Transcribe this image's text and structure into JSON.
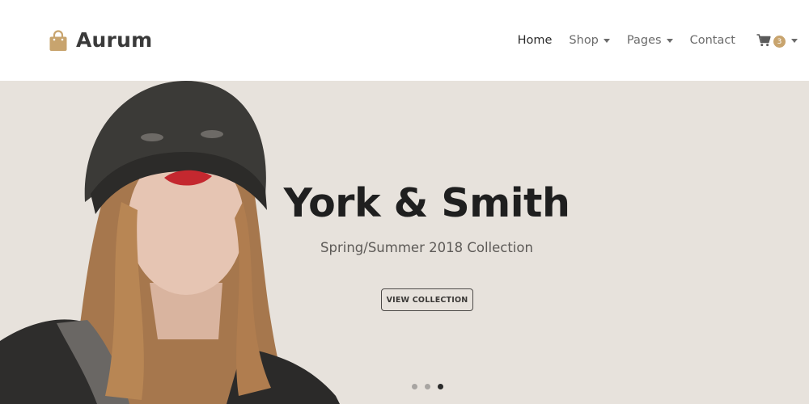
{
  "brand": {
    "name": "Aurum",
    "logo_icon": "shopping-bag-icon",
    "logo_color": "#c8a46e"
  },
  "nav": {
    "items": [
      {
        "label": "Home",
        "active": true,
        "has_dropdown": false
      },
      {
        "label": "Shop",
        "active": false,
        "has_dropdown": true
      },
      {
        "label": "Pages",
        "active": false,
        "has_dropdown": true
      },
      {
        "label": "Contact",
        "active": false,
        "has_dropdown": false
      }
    ],
    "cart": {
      "icon": "cart-icon",
      "count": "3",
      "has_dropdown": true
    }
  },
  "hero": {
    "title": "York & Smith",
    "subtitle": "Spring/Summer 2018 Collection",
    "button_label": "VIEW COLLECTION",
    "image": "woman-in-beanie-photo",
    "background_color": "#e7e2dc",
    "slides": 3,
    "active_slide": 3
  },
  "colors": {
    "accent": "#c8a46e",
    "text_dark": "#2a2a2a",
    "text_muted": "#6b6b6b"
  }
}
